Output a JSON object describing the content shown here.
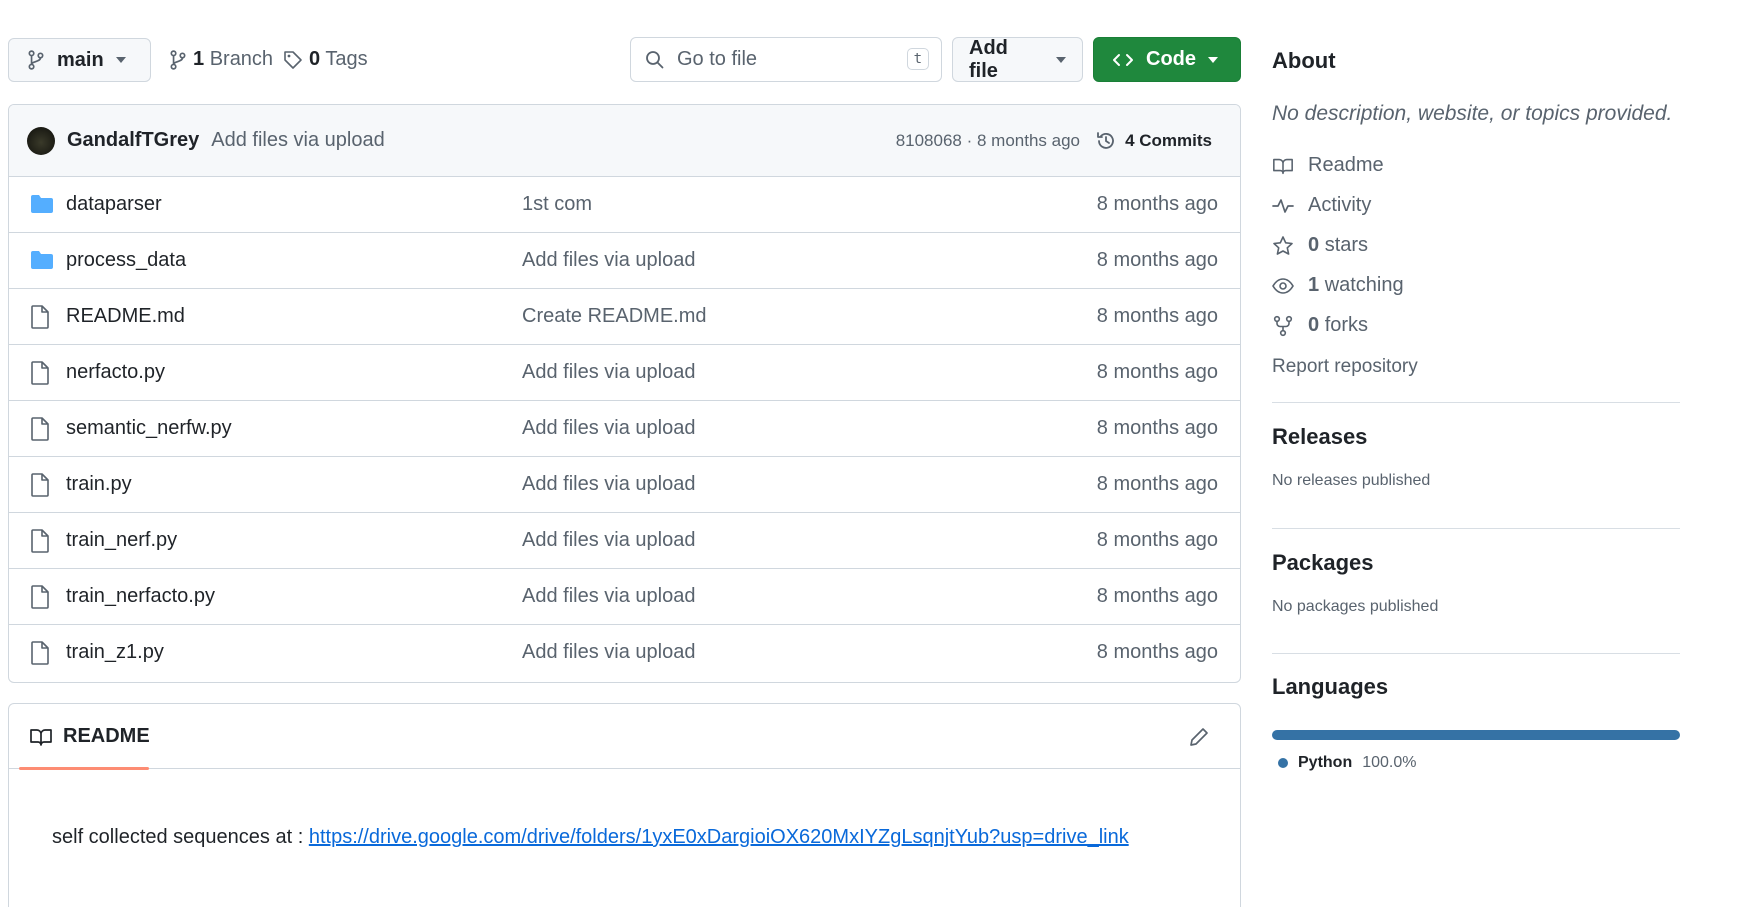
{
  "toolbar": {
    "branch_name": "main",
    "branch_count": "1",
    "branch_label": "Branch",
    "tag_count": "0",
    "tag_label": "Tags",
    "goto_placeholder": "Go to file",
    "goto_shortcut": "t",
    "add_file_label": "Add file",
    "code_label": "Code",
    "code_color": "#1f883d"
  },
  "latest_commit": {
    "author": "GandalfTGrey",
    "message": "Add files via upload",
    "meta": "8108068 · 8 months ago",
    "commits_label": "4 Commits"
  },
  "files": [
    {
      "name": "dataparser",
      "type": "folder",
      "message": "1st com",
      "age": "8 months ago"
    },
    {
      "name": "process_data",
      "type": "folder",
      "message": "Add files via upload",
      "age": "8 months ago"
    },
    {
      "name": "README.md",
      "type": "file",
      "message": "Create README.md",
      "age": "8 months ago"
    },
    {
      "name": "nerfacto.py",
      "type": "file",
      "message": "Add files via upload",
      "age": "8 months ago"
    },
    {
      "name": "semantic_nerfw.py",
      "type": "file",
      "message": "Add files via upload",
      "age": "8 months ago"
    },
    {
      "name": "train.py",
      "type": "file",
      "message": "Add files via upload",
      "age": "8 months ago"
    },
    {
      "name": "train_nerf.py",
      "type": "file",
      "message": "Add files via upload",
      "age": "8 months ago"
    },
    {
      "name": "train_nerfacto.py",
      "type": "file",
      "message": "Add files via upload",
      "age": "8 months ago"
    },
    {
      "name": "train_z1.py",
      "type": "file",
      "message": "Add files via upload",
      "age": "8 months ago"
    }
  ],
  "readme": {
    "tab_label": "README",
    "text": "self collected sequences at : ",
    "link_text": "https://drive.google.com/drive/folders/1yxE0xDargioiOX620MxIYZgLsqnjtYub?usp=drive_link"
  },
  "sidebar": {
    "about_title": "About",
    "about_desc": "No description, website, or topics provided.",
    "readme_label": "Readme",
    "activity_label": "Activity",
    "stars_count": "0",
    "stars_label": "stars",
    "watching_count": "1",
    "watching_label": "watching",
    "forks_count": "0",
    "forks_label": "forks",
    "report_label": "Report repository",
    "releases_title": "Releases",
    "releases_text": "No releases published",
    "packages_title": "Packages",
    "packages_text": "No packages published",
    "languages_title": "Languages",
    "language_name": "Python",
    "language_percent": "100.0%",
    "language_color": "#3572a5"
  }
}
